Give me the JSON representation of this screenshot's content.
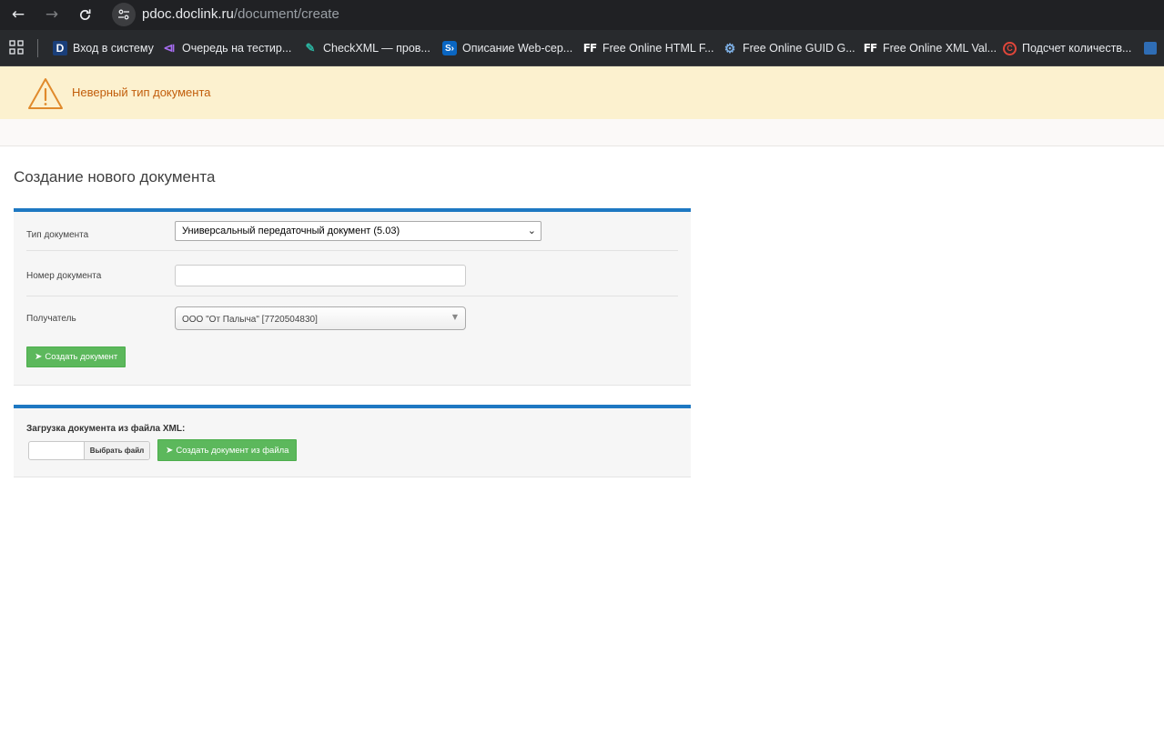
{
  "browser": {
    "url_host": "pdoc.doclink.ru",
    "url_path": "/document/create",
    "bookmarks": [
      {
        "label": "Вход в систему",
        "icon": "doclink-d-icon"
      },
      {
        "label": "Очередь на тестир...",
        "icon": "visual-studio-icon"
      },
      {
        "label": "CheckXML — пров...",
        "icon": "checkxml-icon"
      },
      {
        "label": "Описание Web-сер...",
        "icon": "sharepoint-icon"
      },
      {
        "label": "Free Online HTML F...",
        "icon": "freeformatter-icon"
      },
      {
        "label": "Free Online GUID G...",
        "icon": "gears-icon"
      },
      {
        "label": "Free Online XML Val...",
        "icon": "freeformatter-icon"
      },
      {
        "label": "Подсчет количеств...",
        "icon": "copyright-icon"
      }
    ]
  },
  "alert": {
    "text": "Неверный тип документа",
    "icon": "warning-icon",
    "color": "#c25e0c",
    "background": "#fcf1cf"
  },
  "page": {
    "title": "Создание нового документа"
  },
  "form": {
    "doc_type_label": "Тип документа",
    "doc_type_value": "Универсальный передаточный документ (5.03)",
    "doc_number_label": "Номер документа",
    "doc_number_value": "",
    "recipient_label": "Получатель",
    "recipient_value": "ООО \"От Палыча\" [7720504830]",
    "create_button": "Создать документ"
  },
  "upload": {
    "label": "Загрузка документа из файла XML:",
    "browse_button": "Выбрать файл",
    "create_from_file_button": "Создать документ из файла"
  },
  "colors": {
    "accent": "#1e78c2",
    "button_green": "#5cb85c"
  }
}
